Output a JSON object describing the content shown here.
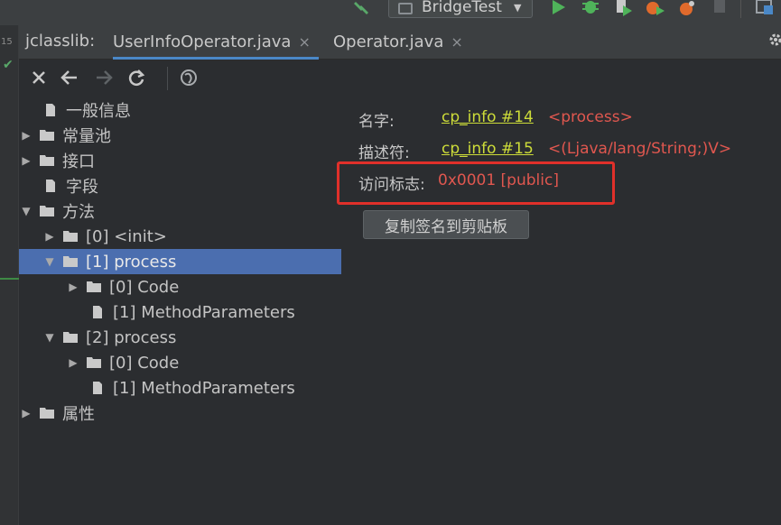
{
  "toolbar": {
    "run_config_label": "BridgeTest"
  },
  "gutter": {
    "line_number": "15"
  },
  "tabs": {
    "plugin_label": "jclasslib:",
    "items": [
      {
        "label": "UserInfoOperator.java",
        "active": true
      },
      {
        "label": "Operator.java",
        "active": false
      }
    ],
    "close_glyph": "×"
  },
  "tree": {
    "general_info": "一般信息",
    "constant_pool": "常量池",
    "interfaces": "接口",
    "fields": "字段",
    "methods": "方法",
    "method_0": "[0] <init>",
    "method_1": "[1] process",
    "method_1_code": "[0] Code",
    "method_1_params": "[1] MethodParameters",
    "method_2": "[2] process",
    "method_2_code": "[0] Code",
    "method_2_params": "[1] MethodParameters",
    "attributes": "属性"
  },
  "detail": {
    "name_label": "名字:",
    "name_link": "cp_info #14",
    "name_value": "<process>",
    "descriptor_label": "描述符:",
    "descriptor_link": "cp_info #15",
    "descriptor_value": "<(Ljava/lang/String;)V>",
    "access_label": "访问标志:",
    "access_value": "0x0001 [public]",
    "copy_button": "复制签名到剪贴板"
  },
  "colors": {
    "selection": "#4b6eaf",
    "link": "#cddc39",
    "value_red": "#e0574f",
    "highlight_box": "#e0302a"
  }
}
